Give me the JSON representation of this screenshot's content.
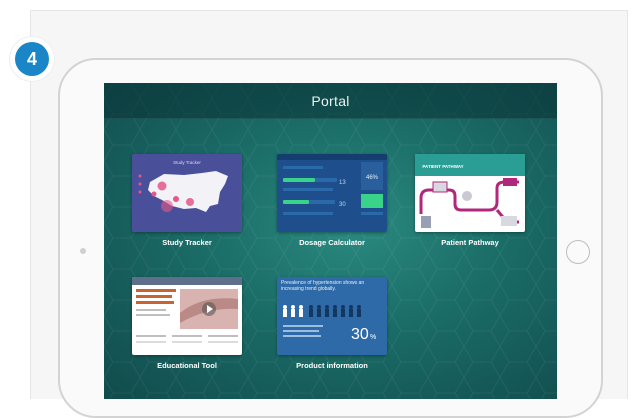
{
  "step": {
    "number": "4"
  },
  "app": {
    "title": "Portal"
  },
  "tiles": [
    {
      "label": "Study Tracker",
      "thumb_title": "Study Tracker"
    },
    {
      "label": "Dosage Calculator",
      "readout_1": "13",
      "readout_2": "30",
      "readout_big": "46%"
    },
    {
      "label": "Patient Pathway",
      "thumb_title": "PATIENT PATHWAY"
    },
    {
      "label": "Educational Tool"
    },
    {
      "label": "Product information",
      "headline": "Prevalence of hypertension shows an increasing trend globally.",
      "stat": "30",
      "stat_unit": "%"
    }
  ],
  "colors": {
    "badge": "#1b86c7",
    "screen": "#1a6b66",
    "header": "#0f4446"
  }
}
